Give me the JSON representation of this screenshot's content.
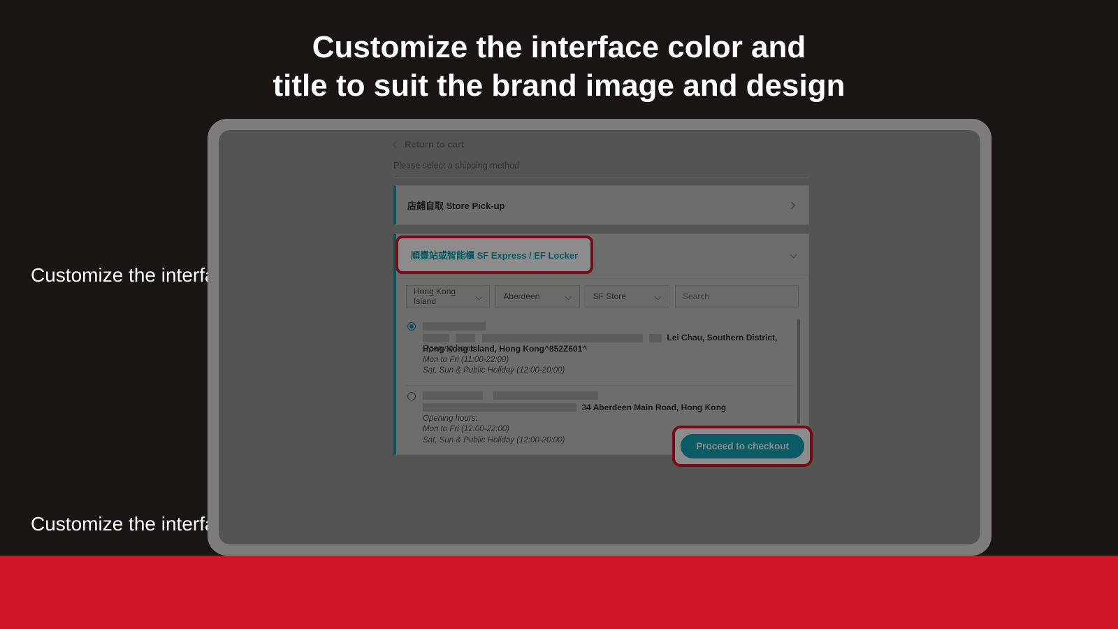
{
  "heading_line1": "Customize the interface color and",
  "heading_line2": "title to suit the brand image and design",
  "callouts": {
    "color1": "Customize the interface color",
    "color2": "Customize the interface color"
  },
  "checkout": {
    "return_label": "Return to cart",
    "instruction": "Please select a shipping method",
    "method_store": "店鋪自取 Store Pick-up",
    "method_sf": "順豐站或智能櫃 SF Express / EF Locker",
    "filters": {
      "region": "Hong Kong Island",
      "district": "Aberdeen",
      "type": "SF Store",
      "search_placeholder": "Search"
    },
    "locations": [
      {
        "selected": true,
        "address_visible": "Lei Chau, Southern District, Hong Kong Island, Hong Kong^852Z601^",
        "hours_label": "Opening hours:",
        "hours1": "Mon to Fri (11:00-22:00)",
        "hours2": "Sat, Sun & Public Holiday (12:00-20:00)"
      },
      {
        "selected": false,
        "address_visible": "34 Aberdeen Main Road, Hong Kong",
        "hours_label": "Opening hours:",
        "hours1": "Mon to Fri (12:00-22:00)",
        "hours2": "Sat, Sun & Public Holiday (12:00-20:00)"
      }
    ],
    "proceed_label": "Proceed to checkout"
  },
  "colors": {
    "accent_teal": "#14a7b9",
    "highlight_red": "#d6172b"
  }
}
